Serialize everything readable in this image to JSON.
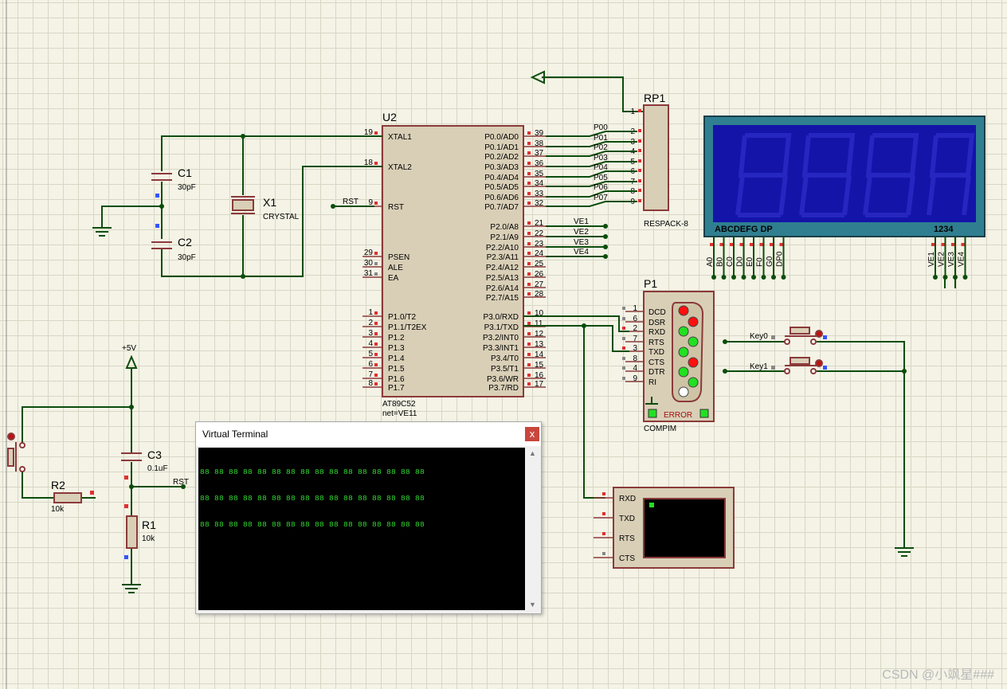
{
  "components": {
    "u2": {
      "ref": "U2",
      "part": "AT89C52",
      "net": "net=VE11"
    },
    "c1": {
      "ref": "C1",
      "value": "30pF"
    },
    "c2": {
      "ref": "C2",
      "value": "30pF"
    },
    "x1": {
      "ref": "X1",
      "value": "CRYSTAL"
    },
    "c3": {
      "ref": "C3",
      "value": "0.1uF"
    },
    "r1": {
      "ref": "R1",
      "value": "10k"
    },
    "r2": {
      "ref": "R2",
      "value": "10k"
    },
    "rp1": {
      "ref": "RP1",
      "value": "RESPACK-8"
    },
    "p1": {
      "ref": "P1",
      "part": "COMPIM",
      "error": "ERROR"
    },
    "power": "+5V",
    "key0": "Key0",
    "key1": "Key1",
    "display": {
      "seg_label": "ABCDEFG DP",
      "digit_label": "1234"
    }
  },
  "u2_left_pins": [
    {
      "num": "19",
      "name": "XTAL1"
    },
    {
      "num": "18",
      "name": "XTAL2"
    },
    {
      "num": "9",
      "name": "RST"
    },
    {
      "num": "29",
      "name": "PSEN"
    },
    {
      "num": "30",
      "name": "ALE"
    },
    {
      "num": "31",
      "name": "EA"
    },
    {
      "num": "1",
      "name": "P1.0/T2"
    },
    {
      "num": "2",
      "name": "P1.1/T2EX"
    },
    {
      "num": "3",
      "name": "P1.2"
    },
    {
      "num": "4",
      "name": "P1.3"
    },
    {
      "num": "5",
      "name": "P1.4"
    },
    {
      "num": "6",
      "name": "P1.5"
    },
    {
      "num": "7",
      "name": "P1.6"
    },
    {
      "num": "8",
      "name": "P1.7"
    }
  ],
  "u2_right_pins": [
    {
      "num": "39",
      "name": "P0.0/AD0"
    },
    {
      "num": "38",
      "name": "P0.1/AD1"
    },
    {
      "num": "37",
      "name": "P0.2/AD2"
    },
    {
      "num": "36",
      "name": "P0.3/AD3"
    },
    {
      "num": "35",
      "name": "P0.4/AD4"
    },
    {
      "num": "34",
      "name": "P0.5/AD5"
    },
    {
      "num": "33",
      "name": "P0.6/AD6"
    },
    {
      "num": "32",
      "name": "P0.7/AD7"
    },
    {
      "num": "21",
      "name": "P2.0/A8"
    },
    {
      "num": "22",
      "name": "P2.1/A9"
    },
    {
      "num": "23",
      "name": "P2.2/A10"
    },
    {
      "num": "24",
      "name": "P2.3/A11"
    },
    {
      "num": "25",
      "name": "P2.4/A12"
    },
    {
      "num": "26",
      "name": "P2.5/A13"
    },
    {
      "num": "27",
      "name": "P2.6/A14"
    },
    {
      "num": "28",
      "name": "P2.7/A15"
    },
    {
      "num": "10",
      "name": "P3.0/RXD"
    },
    {
      "num": "11",
      "name": "P3.1/TXD"
    },
    {
      "num": "12",
      "name": "P3.2/INT0"
    },
    {
      "num": "13",
      "name": "P3.3/INT1"
    },
    {
      "num": "14",
      "name": "P3.4/T0"
    },
    {
      "num": "15",
      "name": "P3.5/T1"
    },
    {
      "num": "16",
      "name": "P3.6/WR"
    },
    {
      "num": "17",
      "name": "P3.7/RD"
    }
  ],
  "p0_nets": [
    "P00",
    "P01",
    "P02",
    "P03",
    "P04",
    "P05",
    "P06",
    "P07"
  ],
  "p2_nets": [
    "VE1",
    "VE2",
    "VE3",
    "VE4"
  ],
  "rp1_pins": [
    "1",
    "2",
    "3",
    "4",
    "5",
    "6",
    "7",
    "8",
    "9"
  ],
  "compim_pins": [
    {
      "num": "1",
      "name": "DCD"
    },
    {
      "num": "6",
      "name": "DSR"
    },
    {
      "num": "2",
      "name": "RXD"
    },
    {
      "num": "7",
      "name": "RTS"
    },
    {
      "num": "3",
      "name": "TXD"
    },
    {
      "num": "8",
      "name": "CTS"
    },
    {
      "num": "4",
      "name": "DTR"
    },
    {
      "num": "9",
      "name": "RI"
    }
  ],
  "seg_pins": [
    "A0",
    "B0",
    "C0",
    "D0",
    "E0",
    "F0",
    "G0",
    "DP0"
  ],
  "digit_pins": [
    "VE1",
    "VE2",
    "VE3",
    "VE4"
  ],
  "vterm_pins": [
    "RXD",
    "TXD",
    "RTS",
    "CTS"
  ],
  "rst_net": "RST",
  "virtual_terminal": {
    "title": "Virtual Terminal",
    "close": "x",
    "lines": [
      "88 88 88 88 88 88 88 88 88 88 88 88 88 88 88 88",
      "88 88 88 88 88 88 88 88 88 88 88 88 88 88 88 88",
      "88 88 88 88 88 88 88 88 88 88 88 88 88 88 88 88"
    ]
  },
  "watermark": "CSDN @小飒星###"
}
